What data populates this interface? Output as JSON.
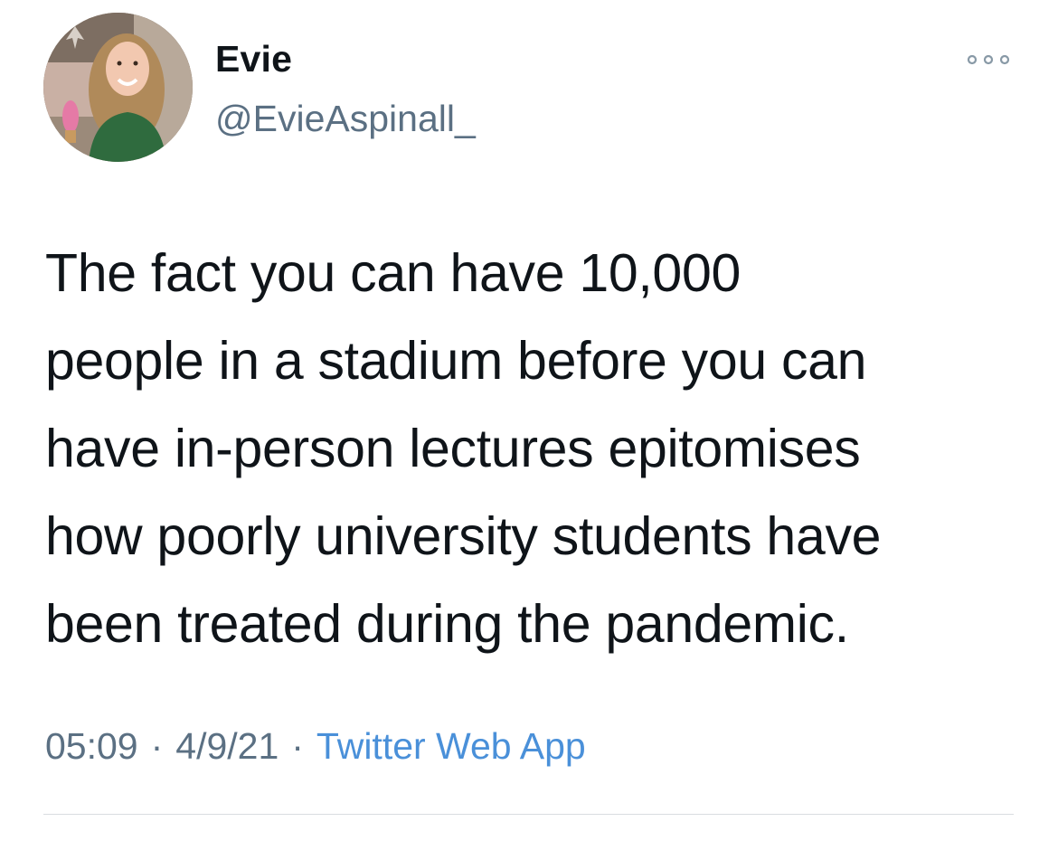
{
  "author": {
    "display_name": "Evie",
    "handle": "@EvieAspinall_",
    "avatar_icon": "profile-photo"
  },
  "tweet": {
    "text_lines": [
      "The fact you can have 10,000",
      "people in a stadium before you can",
      "have in-person lectures epitomises",
      "how poorly university students have",
      "been treated during the pandemic."
    ],
    "time": "05:09",
    "date": "4/9/21",
    "separator": "·",
    "source": "Twitter Web App"
  },
  "icons": {
    "more": "more-dots-icon"
  },
  "colors": {
    "text": "#0f1419",
    "secondary": "#5b7083",
    "link": "#4a90d9",
    "divider": "#d9dde0"
  }
}
